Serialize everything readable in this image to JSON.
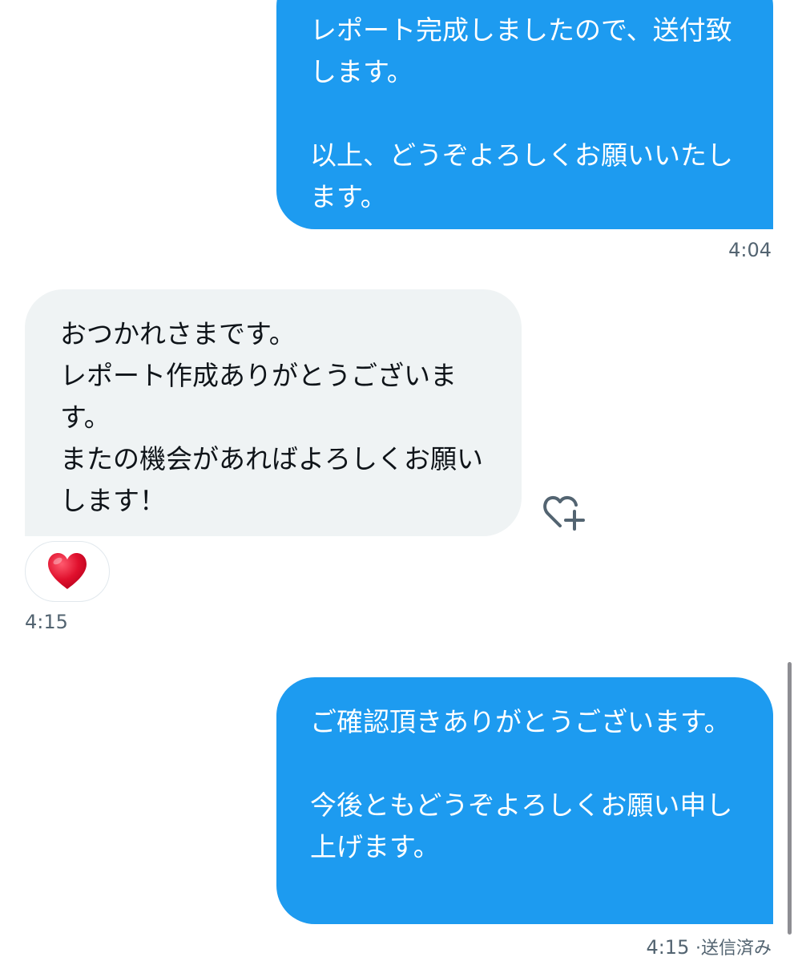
{
  "conversation": {
    "messages": [
      {
        "direction": "sent",
        "text": "レポート完成しましたので、送付致します。\n\n以上、どうぞよろしくお願いいたします。",
        "time": "4:04"
      },
      {
        "direction": "received",
        "text": "おつかれさまです。\nレポート作成ありがとうございます。\nまたの機会があればよろしくお願いします！",
        "time": "4:15",
        "reaction": {
          "icon": "red-heart-icon",
          "color": "#e0102d"
        },
        "add_reaction_icon": "heart-plus-icon"
      },
      {
        "direction": "sent",
        "text": "ご確認頂きありがとうございます。\n\n今後ともどうぞよろしくお願い申し上げます。",
        "time": "4:15",
        "status": "·送信済み"
      }
    ]
  },
  "colors": {
    "sent_bubble": "#1d9bf0",
    "received_bubble": "#eff3f4",
    "timestamp": "#536471"
  }
}
